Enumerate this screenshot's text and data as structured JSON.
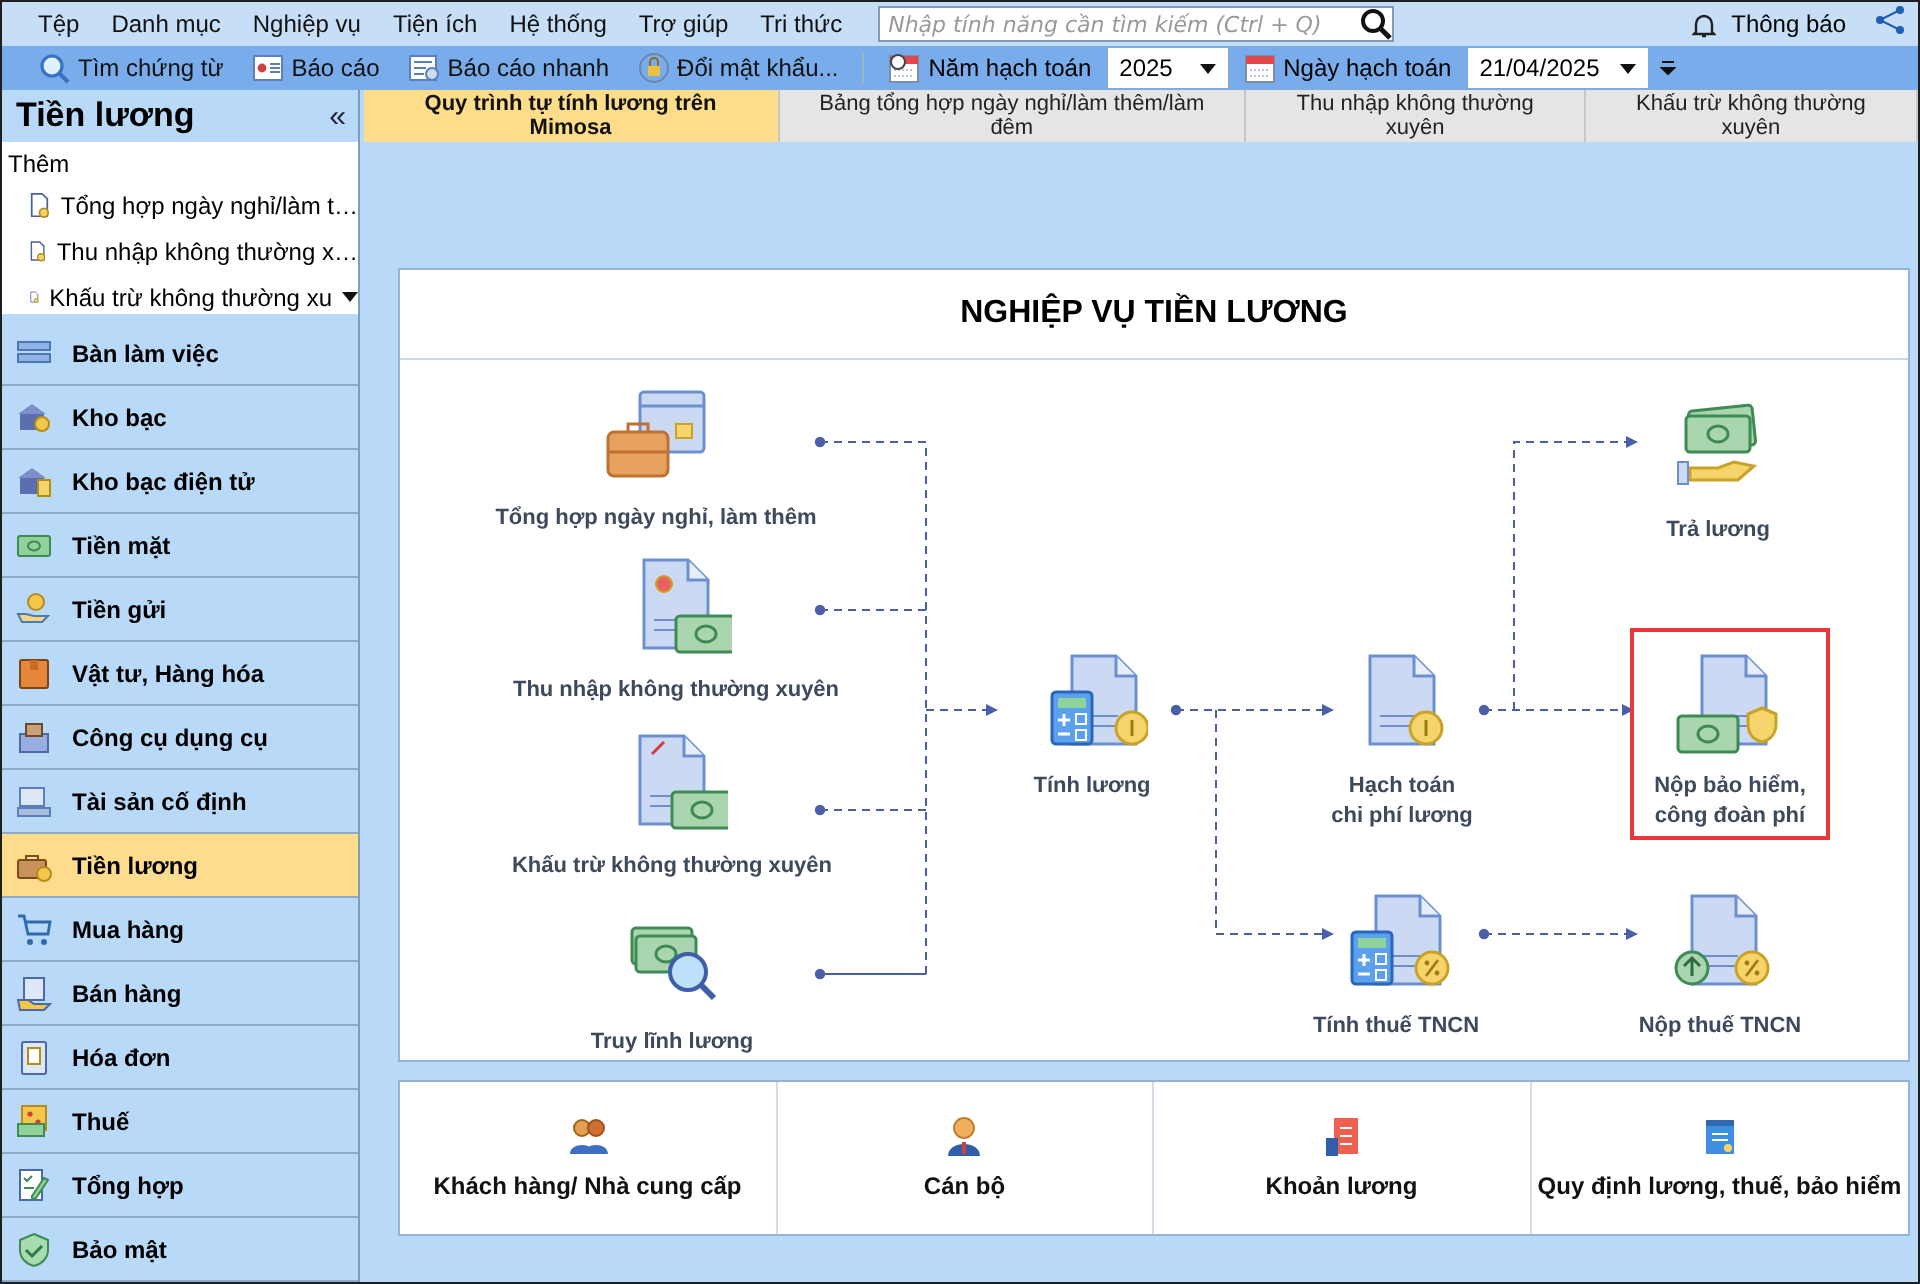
{
  "menu": [
    {
      "label": "Tệp"
    },
    {
      "label": "Danh mục"
    },
    {
      "label": "Nghiệp vụ"
    },
    {
      "label": "Tiện ích"
    },
    {
      "label": "Hệ thống"
    },
    {
      "label": "Trợ giúp"
    },
    {
      "label": "Tri thức"
    }
  ],
  "search": {
    "placeholder": "Nhập tính năng cần tìm kiếm (Ctrl + Q)"
  },
  "notification": {
    "label": "Thông báo"
  },
  "toolbar": {
    "buttons": [
      {
        "label": "Tìm chứng từ"
      },
      {
        "label": "Báo cáo"
      },
      {
        "label": "Báo cáo nhanh"
      },
      {
        "label": "Đổi mật khẩu..."
      }
    ],
    "year_label": "Năm hạch toán",
    "year": "2025",
    "date_label": "Ngày hạch toán",
    "date": "21/04/2025"
  },
  "sidebar": {
    "title": "Tiền lương",
    "collapse_glyph": "«",
    "add_label": "Thêm",
    "quick_items": [
      {
        "label": "Tổng hợp ngày nghỉ/làm t…"
      },
      {
        "label": "Thu nhập không thường x…"
      },
      {
        "label": "Khấu trừ không thường xu"
      }
    ],
    "nav_items": [
      {
        "label": "Bàn làm việc",
        "selected": false
      },
      {
        "label": "Kho bạc",
        "selected": false
      },
      {
        "label": "Kho bạc điện tử",
        "selected": false
      },
      {
        "label": "Tiền mặt",
        "selected": false
      },
      {
        "label": "Tiền gửi",
        "selected": false
      },
      {
        "label": "Vật tư, Hàng hóa",
        "selected": false
      },
      {
        "label": "Công cụ dụng cụ",
        "selected": false
      },
      {
        "label": "Tài sản cố định",
        "selected": false
      },
      {
        "label": "Tiền lương",
        "selected": true
      },
      {
        "label": "Mua hàng",
        "selected": false
      },
      {
        "label": "Bán hàng",
        "selected": false
      },
      {
        "label": "Hóa đơn",
        "selected": false
      },
      {
        "label": "Thuế",
        "selected": false
      },
      {
        "label": "Tổng hợp",
        "selected": false
      },
      {
        "label": "Bảo mật",
        "selected": false
      }
    ]
  },
  "tabs": [
    {
      "label": "Quy trình tự tính lương trên Mimosa",
      "selected": true
    },
    {
      "label": "Bảng tổng hợp ngày nghỉ/làm thêm/làm đêm",
      "selected": false
    },
    {
      "label": "Thu nhập không thường xuyên",
      "selected": false
    },
    {
      "label": "Khấu trừ không thường xuyên",
      "selected": false
    }
  ],
  "workflow": {
    "title": "NGHIỆP VỤ TIỀN LƯƠNG",
    "nodes": [
      {
        "label": "Tổng hợp ngày nghỉ, làm thêm",
        "highlighted": false
      },
      {
        "label": "Thu nhập không thường xuyên",
        "highlighted": false
      },
      {
        "label": "Khấu trừ không thường xuyên",
        "highlighted": false
      },
      {
        "label": "Truy lĩnh lương",
        "highlighted": false
      },
      {
        "label": "Tính lương",
        "highlighted": false
      },
      {
        "label": "Hạch toán\nchi phí lương",
        "highlighted": false
      },
      {
        "label": "Trả lương",
        "highlighted": false
      },
      {
        "label": "Nộp bảo hiểm,\ncông đoàn phí",
        "highlighted": true
      },
      {
        "label": "Tính thuế TNCN",
        "highlighted": false
      },
      {
        "label": "Nộp thuế TNCN",
        "highlighted": false
      }
    ]
  },
  "shortcuts": [
    {
      "label": "Khách hàng/ Nhà cung cấp"
    },
    {
      "label": "Cán bộ"
    },
    {
      "label": "Khoản lương"
    },
    {
      "label": "Quy định lương, thuế, bảo hiểm"
    }
  ]
}
